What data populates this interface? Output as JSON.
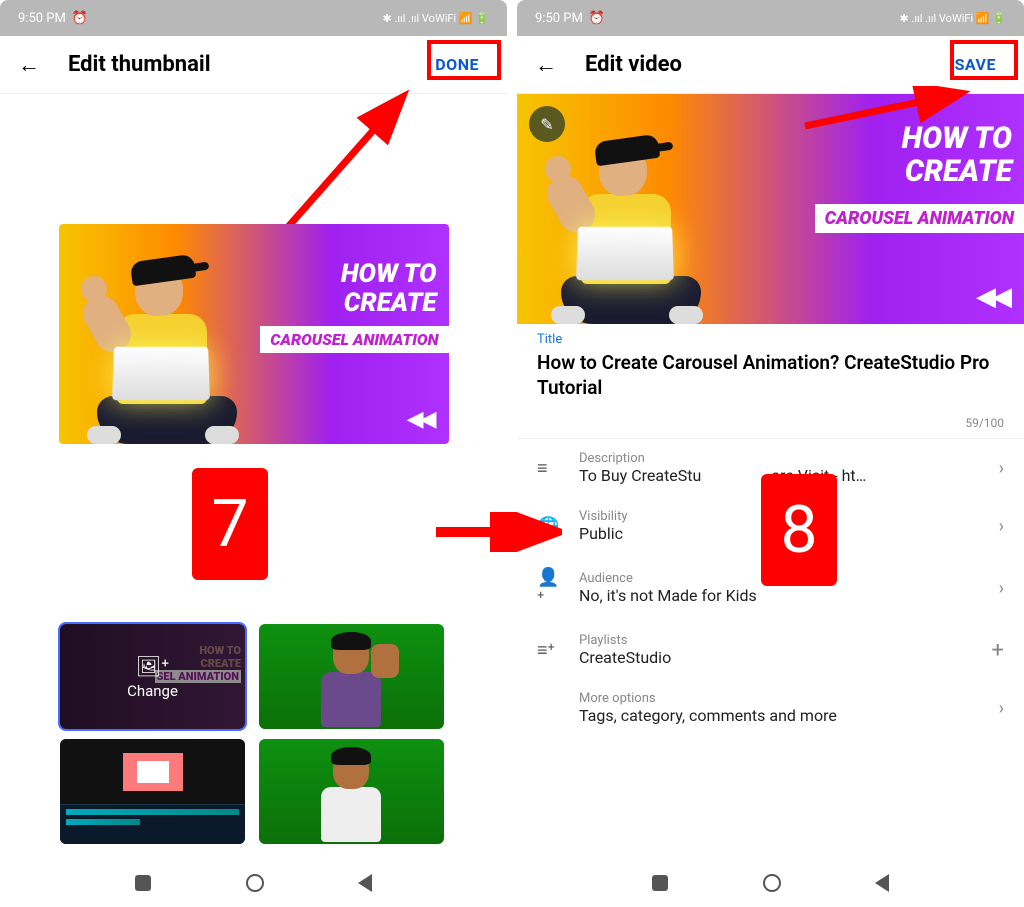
{
  "status": {
    "time": "9:50 PM",
    "icons": "⏰  ✱ .ııl .ııl ⩙ ᐯoWiFi ⌇ ⏚ 50"
  },
  "left": {
    "title": "Edit thumbnail",
    "done": "DONE",
    "thumb": {
      "line1": "HOW TO",
      "line2": "CREATE",
      "banner": "CAROUSEL ANIMATION"
    },
    "change": "Change",
    "step": "7",
    "option1bg1": "HOW TO",
    "option1bg2": "CREATE",
    "option1bg3": "SEL  ANIMATION"
  },
  "right": {
    "title": "Edit video",
    "save": "SAVE",
    "thumb": {
      "line1": "HOW TO",
      "line2": "CREATE",
      "banner": "CAROUSEL ANIMATION"
    },
    "titleField": {
      "label": "Title",
      "value": "How to Create Carousel Animation? CreateStudio Pro Tutorial",
      "count": "59/100"
    },
    "rows": {
      "description": {
        "label": "Description",
        "value_a": "To Buy CreateStu",
        "value_b": "are Visit - ht…"
      },
      "visibility": {
        "label": "Visibility",
        "value": "Public"
      },
      "audience": {
        "label": "Audience",
        "value": "No, it's not Made for Kids"
      },
      "playlists": {
        "label": "Playlists",
        "value": "CreateStudio"
      },
      "more": {
        "label": "More options",
        "value": "Tags, category, comments and more"
      }
    },
    "step": "8"
  }
}
